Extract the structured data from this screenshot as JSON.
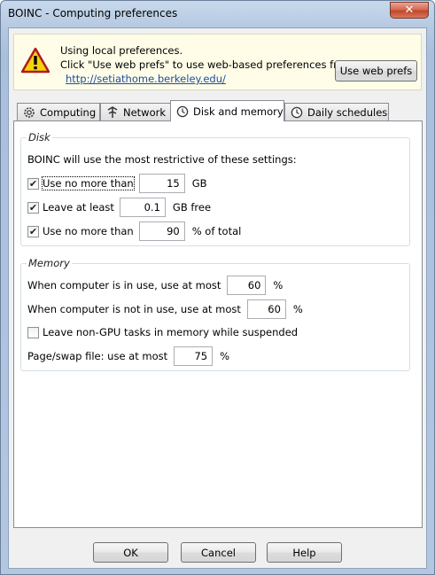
{
  "window": {
    "title": "BOINC - Computing preferences",
    "close_glyph": "✕"
  },
  "notice": {
    "line1": "Using local preferences.",
    "line2": "Click \"Use web prefs\" to use web-based preferences from",
    "link": "http://setiathome.berkeley.edu/",
    "button": "Use web prefs",
    "icon": "warning-icon"
  },
  "tabs": [
    {
      "label": "Computing",
      "icon": "gear-icon"
    },
    {
      "label": "Network",
      "icon": "network-icon"
    },
    {
      "label": "Disk and memory",
      "icon": "clock-icon",
      "active": true
    },
    {
      "label": "Daily schedules",
      "icon": "clock-icon"
    }
  ],
  "disk": {
    "title": "Disk",
    "intro": "BOINC will use the most restrictive of these settings:",
    "use_no_more_than": {
      "label": "Use no more than",
      "value": "15",
      "unit": "GB",
      "checked": true
    },
    "leave_at_least": {
      "label": "Leave at least",
      "value": "0.1",
      "unit": "GB free",
      "checked": true
    },
    "use_pct": {
      "label": "Use no more than",
      "value": "90",
      "unit": "% of total",
      "checked": true
    }
  },
  "memory": {
    "title": "Memory",
    "in_use": {
      "label": "When computer is in use, use at most",
      "value": "60",
      "unit": "%"
    },
    "not_in_use": {
      "label": "When computer is not in use, use at most",
      "value": "60",
      "unit": "%"
    },
    "leave_non_gpu": {
      "label": "Leave non-GPU tasks in memory while suspended",
      "checked": false
    },
    "swap": {
      "label": "Page/swap file: use at most",
      "value": "75",
      "unit": "%"
    }
  },
  "buttons": {
    "ok": "OK",
    "cancel": "Cancel",
    "help": "Help"
  },
  "checkmark": "✔"
}
